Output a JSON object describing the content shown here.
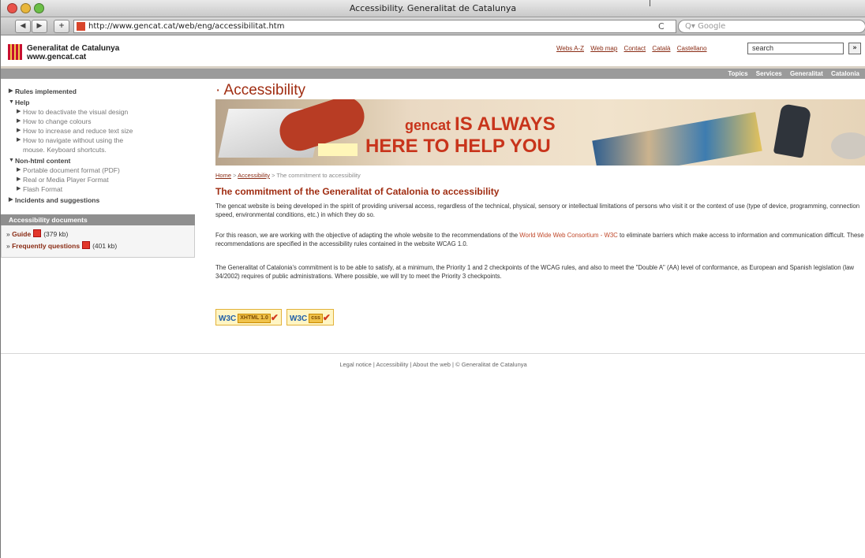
{
  "window": {
    "title": "Accessibility. Generalitat de Catalunya"
  },
  "browser": {
    "back": "◀",
    "forward": "▶",
    "add": "+",
    "url": "http://www.gencat.cat/web/eng/accessibilitat.htm",
    "reload": "C",
    "search_placeholder": "Q▾ Google"
  },
  "site": {
    "brand": {
      "line1": "Generalitat de Catalunya",
      "line2": "www.gencat.cat"
    },
    "toplinks": [
      "Webs A-Z",
      "Web map",
      "Contact",
      "Català",
      "Castellano"
    ],
    "search_value": "search",
    "search_go": "»",
    "sections": [
      "Topics",
      "Services",
      "Generalitat",
      "Catalonia"
    ]
  },
  "sidebar": {
    "items": [
      {
        "label": "Rules implemented",
        "mark": "▶",
        "level": "top"
      },
      {
        "label": "Help",
        "mark": "▼",
        "level": "top"
      },
      {
        "label": "How to deactivate the visual design",
        "mark": "▶",
        "level": "sub"
      },
      {
        "label": "How to change colours",
        "mark": "▶",
        "level": "sub"
      },
      {
        "label": "How to increase and reduce text size",
        "mark": "▶",
        "level": "sub"
      },
      {
        "label": "How to navigate without using the",
        "mark": "▶",
        "level": "sub"
      },
      {
        "label": "mouse. Keyboard shortcuts.",
        "mark": "",
        "level": "sub"
      },
      {
        "label": "Non-html content",
        "mark": "▼",
        "level": "top"
      },
      {
        "label": "Portable document format (PDF)",
        "mark": "▶",
        "level": "sub"
      },
      {
        "label": "Real or Media Player Format",
        "mark": "▶",
        "level": "sub"
      },
      {
        "label": "Flash Format",
        "mark": "▶",
        "level": "sub"
      },
      {
        "label": "Incidents and suggestions",
        "mark": "▶",
        "level": "top"
      }
    ],
    "docs_title": "Accessibility documents",
    "docs": [
      {
        "prefix": "» ",
        "name": "Guide",
        "size": "(379 kb)"
      },
      {
        "prefix": "» ",
        "name": "Frequently questions",
        "size": "(401 kb)"
      }
    ]
  },
  "main": {
    "title": "· Accessibility",
    "banner": {
      "line1a": "gencat ",
      "line1b": "IS ALWAYS",
      "line2": "HERE TO HELP YOU"
    },
    "breadcrumb": {
      "home": "Home",
      "sep1": " > ",
      "section": "Accessibility",
      "sep2": " > ",
      "current": "The commitment to accessibility"
    },
    "heading": "The commitment of the Generalitat of Catalonia to accessibility",
    "p1": "The gencat website is being developed in the spirit of providing universal access, regardless of the technical, physical, sensory or intellectual limitations of persons who visit it or the context of use (type of device, programming, connection speed, environmental conditions, etc.) in which they do so.",
    "p2a": "For this reason, we are working with the objective of adapting the whole website to the recommendations of the ",
    "p2link": "World Wide Web Consortium - W3C",
    "p2b": " to eliminate barriers which make access to information and communication difficult. These recommendations are specified in the accessibility rules contained in the website WCAG 1.0.",
    "p3": "The Generalitat of Catalonia's commitment is to be able to satisfy, at a minimum, the Priority 1 and 2 checkpoints of the WCAG rules, and also to meet the \"Double A\" (AA) level of conformance, as European and Spanish legislation (law 34/2002) requires of public administrations. Where possible, we will try to meet the Priority 3 checkpoints.",
    "badges": [
      {
        "w3c": "W3C",
        "label": "XHTML 1.0",
        "check": "✔"
      },
      {
        "w3c": "W3C",
        "label": "css",
        "check": "✔"
      }
    ]
  },
  "footer": "Legal notice | Accessibility | About the web | © Generalitat de Catalunya",
  "colors": {
    "brand_red": "#a02d12",
    "nav_grey": "#9b9b9b",
    "link": "#8a2c15"
  }
}
